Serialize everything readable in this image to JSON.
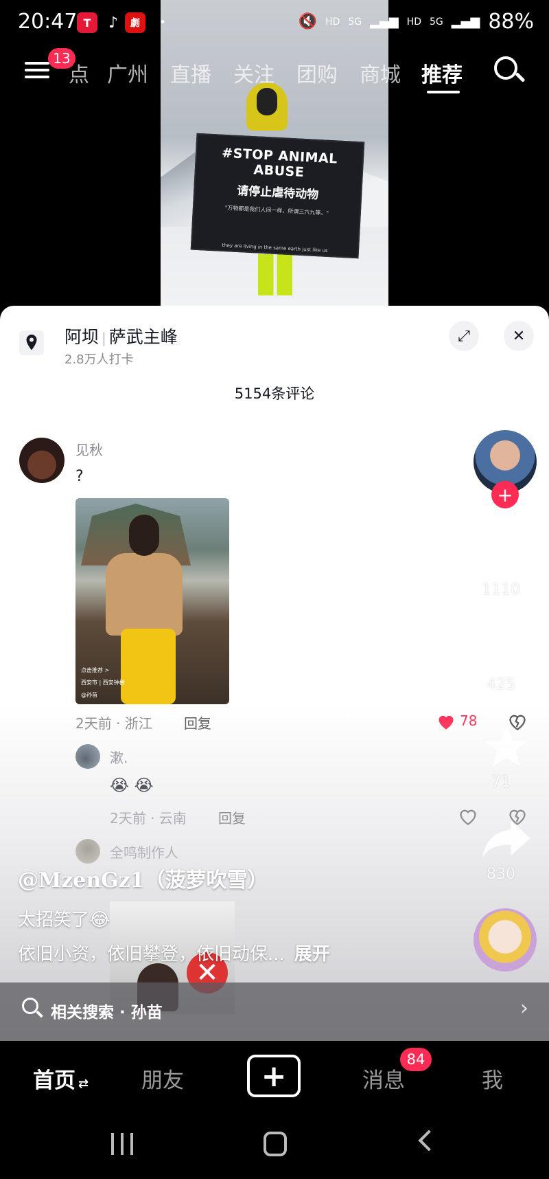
{
  "status_bar": {
    "time": "20:47",
    "battery": "88%",
    "net1": "HD",
    "net2": "5G",
    "net3": "HD",
    "net4": "5G"
  },
  "top_nav": {
    "badge": "13",
    "tabs": [
      "点",
      "广州",
      "直播",
      "关注",
      "团购",
      "商城",
      "推荐"
    ],
    "active_tab": "推荐"
  },
  "video": {
    "banner_line1": "#STOP ANIMAL ABUSE",
    "banner_line2": "请停止虐待动物",
    "banner_line3": "\"万物都是我们人间一样，所谓三六九等。\"",
    "banner_line4": "they are living in the same earth just like us"
  },
  "panel": {
    "location": "阿坝",
    "location_detail": "萨武主峰",
    "checkins": "2.8万人打卡",
    "comment_count": "5154条评论",
    "comment1": {
      "user": "见秋",
      "text": "?",
      "meta": "2天前 · 浙江",
      "reply": "回复",
      "likes": "78",
      "thumb_tag1": "点击推荐 >",
      "thumb_tag2": "西安市 | 西安钟楼",
      "thumb_tag3": "@孙苗"
    },
    "reply1": {
      "user": "漱.",
      "text": "😭 😭",
      "meta": "2天前 · 云南",
      "reply": "回复"
    },
    "reply2": {
      "user": "全鸣制作人"
    }
  },
  "rail": {
    "likes": "1110",
    "comments": "425",
    "favorites": "71",
    "shares": "830"
  },
  "caption": {
    "author": "@MzenGz1（菠萝吹雪）",
    "line1": "太招笑了😂",
    "line2": "依旧小资，依旧攀登，依旧动保...",
    "more": "展开"
  },
  "related_search": {
    "label": "相关搜索 · 孙苗"
  },
  "bottom_nav": {
    "home": "首页",
    "friends": "朋友",
    "messages": "消息",
    "messages_badge": "84",
    "me": "我"
  },
  "colors": {
    "accent": "#fe2c55",
    "panel_bg": "#ffffff",
    "text_primary": "#161823",
    "text_secondary": "#8a8b91"
  }
}
